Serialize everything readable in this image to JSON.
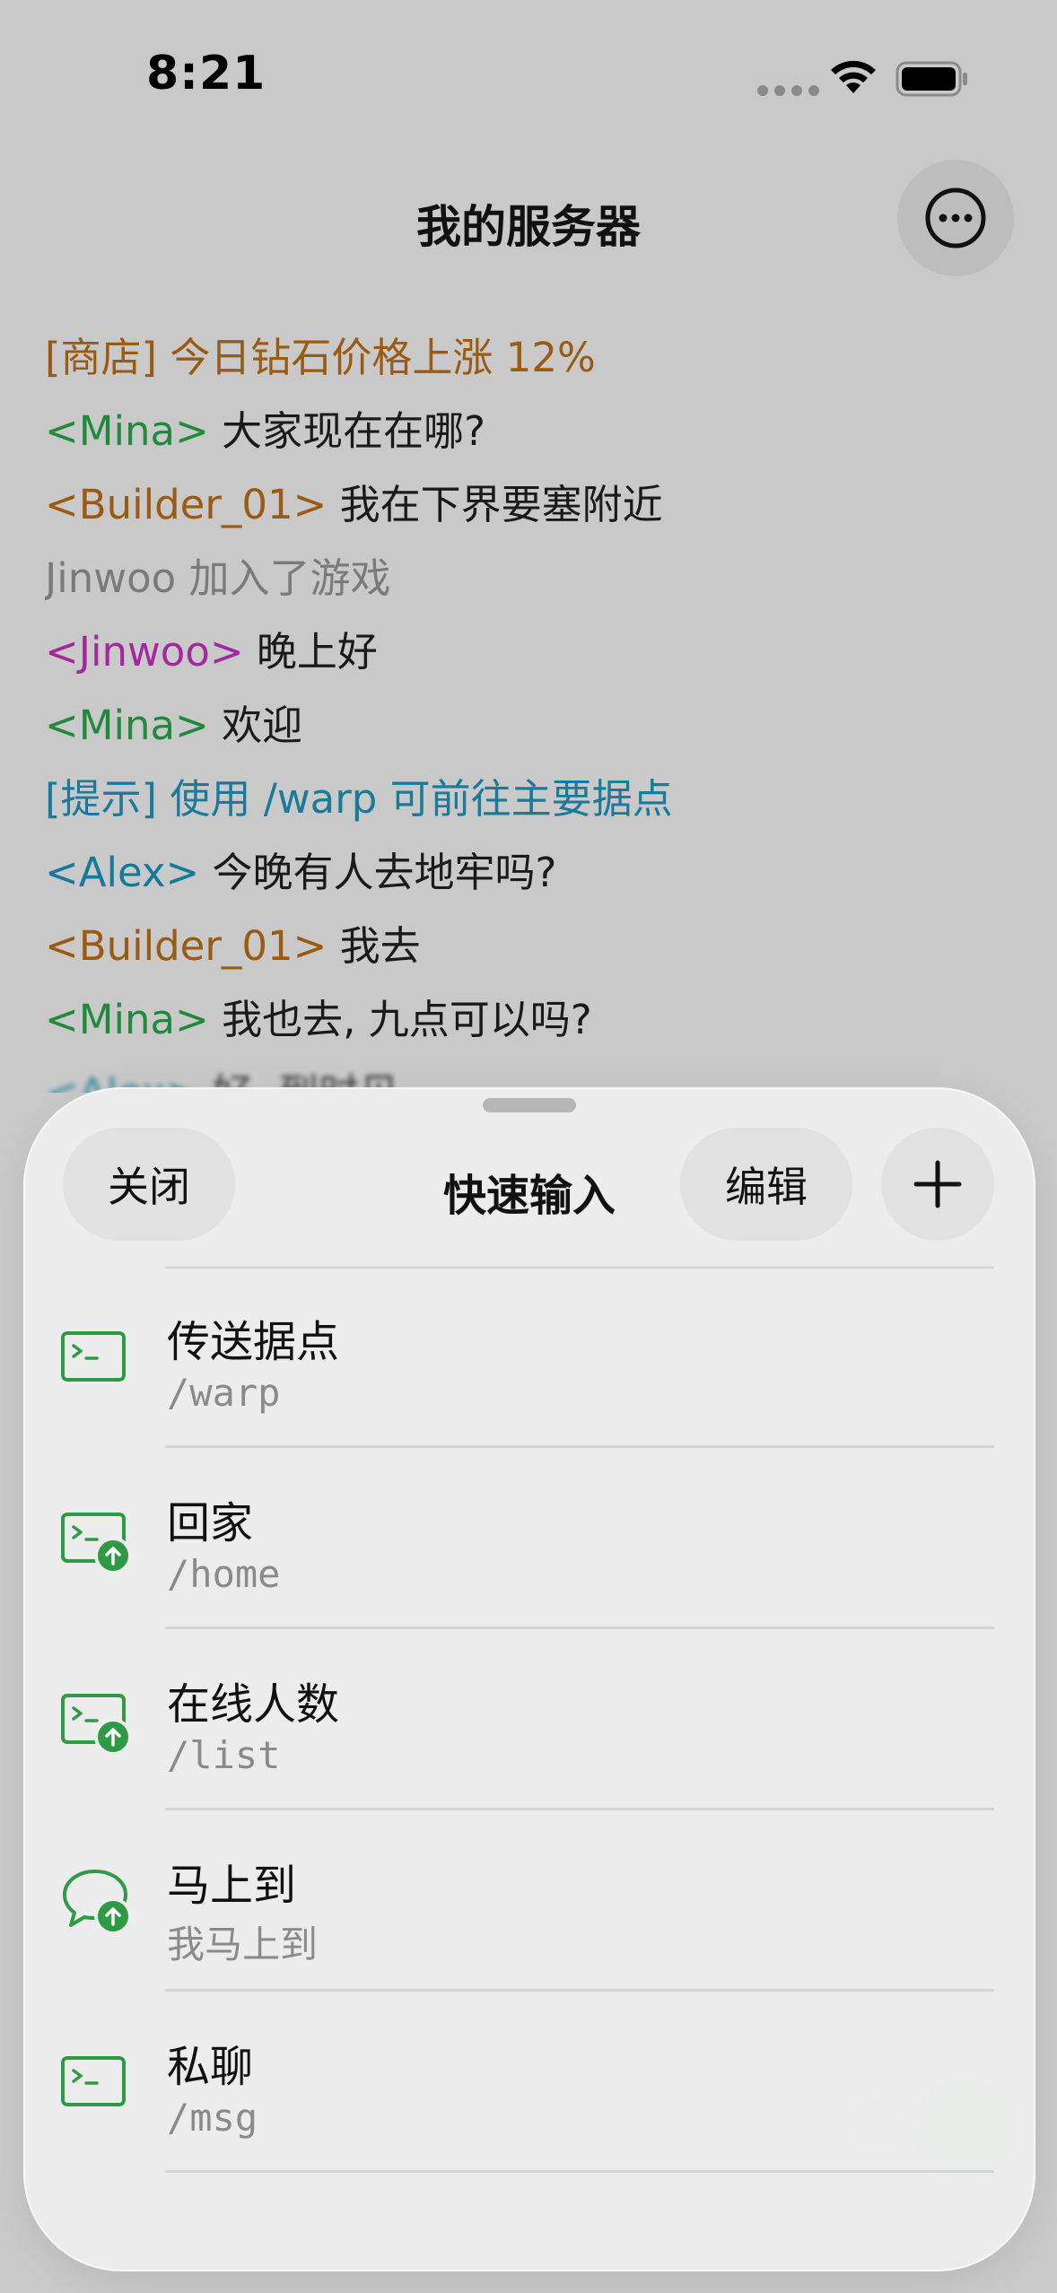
{
  "status_bar": {
    "time": "8:21"
  },
  "nav": {
    "title": "我的服务器"
  },
  "chat": [
    {
      "parts": [
        {
          "text": "[商店] 今日钻石价格上涨 12%",
          "color": "orange"
        }
      ]
    },
    {
      "parts": [
        {
          "text": "<Mina>",
          "color": "green"
        },
        {
          "text": " 大家现在在哪?",
          "color": "default"
        }
      ]
    },
    {
      "parts": [
        {
          "text": "<Builder_01>",
          "color": "orange"
        },
        {
          "text": " 我在下界要塞附近",
          "color": "default"
        }
      ]
    },
    {
      "parts": [
        {
          "text": "Jinwoo 加入了游戏",
          "color": "gray"
        }
      ]
    },
    {
      "parts": [
        {
          "text": "<Jinwoo>",
          "color": "purple"
        },
        {
          "text": " 晚上好",
          "color": "default"
        }
      ]
    },
    {
      "parts": [
        {
          "text": "<Mina>",
          "color": "green"
        },
        {
          "text": " 欢迎",
          "color": "default"
        }
      ]
    },
    {
      "parts": [
        {
          "text": "[提示] 使用 /warp 可前往主要据点",
          "color": "teal"
        }
      ]
    },
    {
      "parts": [
        {
          "text": "<Alex>",
          "color": "blue"
        },
        {
          "text": " 今晚有人去地牢吗?",
          "color": "default"
        }
      ]
    },
    {
      "parts": [
        {
          "text": "<Builder_01>",
          "color": "orange"
        },
        {
          "text": " 我去",
          "color": "default"
        }
      ]
    },
    {
      "parts": [
        {
          "text": "<Mina>",
          "color": "green"
        },
        {
          "text": " 我也去, 九点可以吗?",
          "color": "default"
        }
      ]
    },
    {
      "parts": [
        {
          "text": "<Alex>",
          "color": "blue"
        },
        {
          "text": " 好, 到时见",
          "color": "default"
        }
      ]
    }
  ],
  "sheet": {
    "close_label": "关闭",
    "title": "快速输入",
    "edit_label": "编辑",
    "items": [
      {
        "title": "传送据点",
        "subtitle": "/warp",
        "icon": "terminal-icon",
        "mono": true
      },
      {
        "title": "回家",
        "subtitle": "/home",
        "icon": "terminal-send-icon",
        "mono": true
      },
      {
        "title": "在线人数",
        "subtitle": "/list",
        "icon": "terminal-send-icon",
        "mono": true
      },
      {
        "title": "马上到",
        "subtitle": "我马上到",
        "icon": "chat-send-icon",
        "mono": false
      },
      {
        "title": "私聊",
        "subtitle": "/msg",
        "icon": "terminal-icon",
        "mono": true
      }
    ]
  },
  "colors": {
    "accent": "#2e9a46",
    "orange": "#9a5a12",
    "green": "#1f8a3b",
    "gray": "#7a7a7a",
    "purple": "#a3289c",
    "teal": "#1a7a9a",
    "blue": "#157a9a"
  }
}
